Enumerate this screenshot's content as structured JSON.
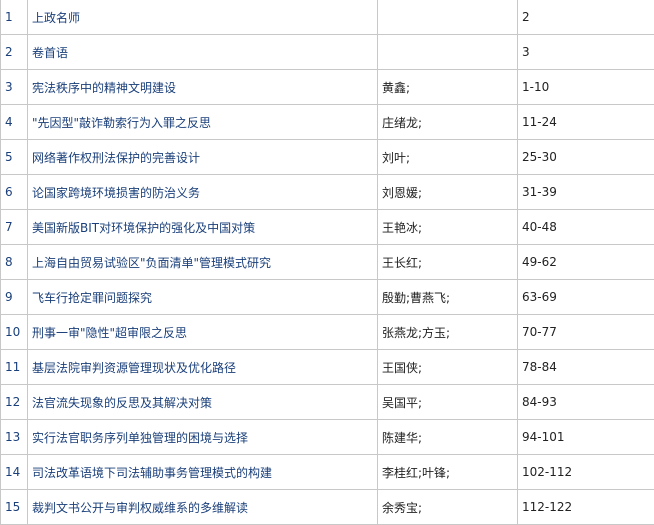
{
  "rows": [
    {
      "num": "1",
      "title": "上政名师",
      "author": "",
      "pages": "2"
    },
    {
      "num": "2",
      "title": "卷首语",
      "author": "",
      "pages": "3"
    },
    {
      "num": "3",
      "title": "宪法秩序中的精神文明建设",
      "author": "黄鑫;",
      "pages": "1-10"
    },
    {
      "num": "4",
      "title": "\"先因型\"敲诈勒索行为入罪之反思",
      "author": "庄绪龙;",
      "pages": "11-24"
    },
    {
      "num": "5",
      "title": "网络著作权刑法保护的完善设计",
      "author": "刘叶;",
      "pages": "25-30"
    },
    {
      "num": "6",
      "title": "论国家跨境环境损害的防治义务",
      "author": "刘恩媛;",
      "pages": "31-39"
    },
    {
      "num": "7",
      "title": "美国新版BIT对环境保护的强化及中国对策",
      "author": "王艳冰;",
      "pages": "40-48"
    },
    {
      "num": "8",
      "title": "上海自由贸易试验区\"负面清单\"管理模式研究",
      "author": "王长红;",
      "pages": "49-62"
    },
    {
      "num": "9",
      "title": "飞车行抢定罪问题探究",
      "author": "殷勤;曹燕飞;",
      "pages": "63-69"
    },
    {
      "num": "10",
      "title": "刑事一审\"隐性\"超审限之反思",
      "author": "张燕龙;方玉;",
      "pages": "70-77"
    },
    {
      "num": "11",
      "title": "基层法院审判资源管理现状及优化路径",
      "author": "王国侠;",
      "pages": "78-84"
    },
    {
      "num": "12",
      "title": "法官流失现象的反思及其解决对策",
      "author": "吴国平;",
      "pages": "84-93"
    },
    {
      "num": "13",
      "title": "实行法官职务序列单独管理的困境与选择",
      "author": "陈建华;",
      "pages": "94-101"
    },
    {
      "num": "14",
      "title": "司法改革语境下司法辅助事务管理模式的构建",
      "author": "李桂红;叶锋;",
      "pages": "102-112"
    },
    {
      "num": "15",
      "title": "裁判文书公开与审判权威维系的多维解读",
      "author": "余秀宝;",
      "pages": "112-122"
    }
  ]
}
